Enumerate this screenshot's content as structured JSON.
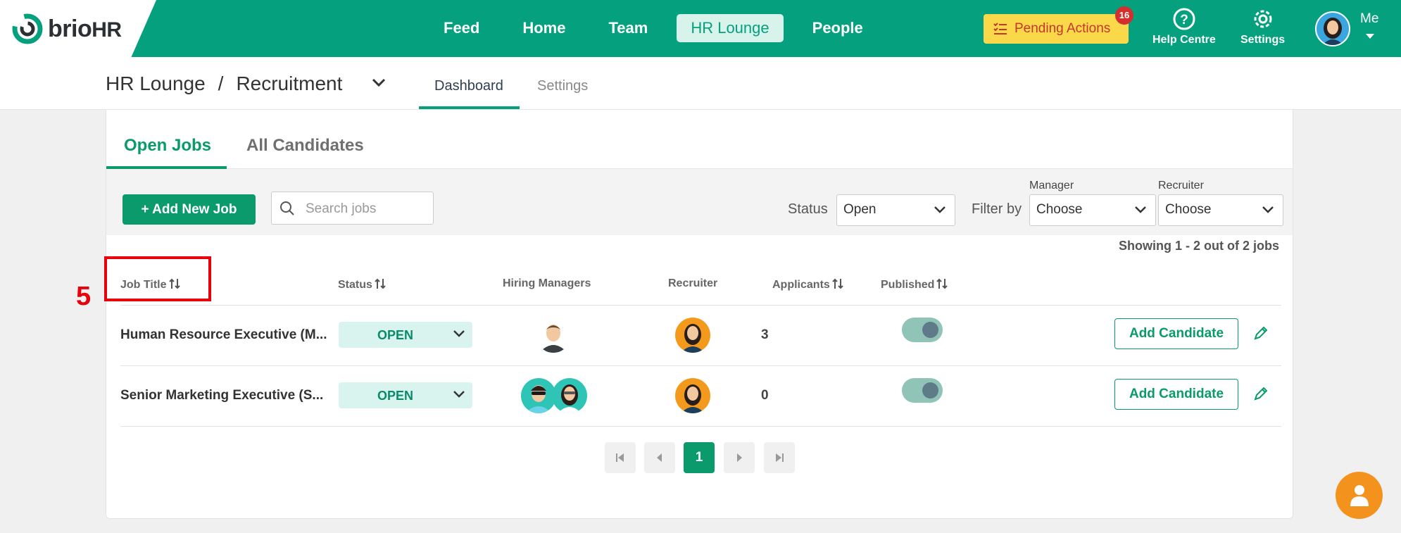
{
  "brand": {
    "name_part": "brio",
    "name_suffix": "HR"
  },
  "nav": {
    "items": [
      "Feed",
      "Home",
      "Team",
      "HR Lounge",
      "People"
    ],
    "active": "HR Lounge"
  },
  "pending_actions": {
    "label": "Pending Actions",
    "count": "16"
  },
  "tools": {
    "help": "Help Centre",
    "settings": "Settings",
    "me": "Me"
  },
  "breadcrumb": {
    "root": "HR Lounge",
    "separator": "/",
    "current": "Recruitment"
  },
  "subtabs": {
    "dashboard": "Dashboard",
    "settings": "Settings"
  },
  "tabs": {
    "open_jobs": "Open Jobs",
    "all_candidates": "All Candidates"
  },
  "toolbar": {
    "add_job": "+ Add New Job",
    "search_placeholder": "Search jobs",
    "status_label": "Status",
    "status_value": "Open",
    "filter_label": "Filter by",
    "manager_label": "Manager",
    "manager_value": "Choose",
    "recruiter_label": "Recruiter",
    "recruiter_value": "Choose"
  },
  "showing": "Showing 1 - 2 out of 2 jobs",
  "table": {
    "headers": {
      "job_title": "Job Title",
      "status": "Status",
      "hiring_managers": "Hiring Managers",
      "recruiter": "Recruiter",
      "applicants": "Applicants",
      "published": "Published"
    },
    "rows": [
      {
        "title": "Human Resource Executive (M...",
        "status": "OPEN",
        "applicants": "3",
        "action": "Add Candidate"
      },
      {
        "title": "Senior Marketing Executive (S...",
        "status": "OPEN",
        "applicants": "0",
        "action": "Add Candidate"
      }
    ]
  },
  "pagination": {
    "current": "1"
  },
  "annotation": {
    "number": "5"
  },
  "colors": {
    "brand": "#05a17e",
    "accent": "#0a9a6b",
    "pending": "#fbd74a",
    "annotation": "#e8000b",
    "fab": "#f4921e"
  }
}
